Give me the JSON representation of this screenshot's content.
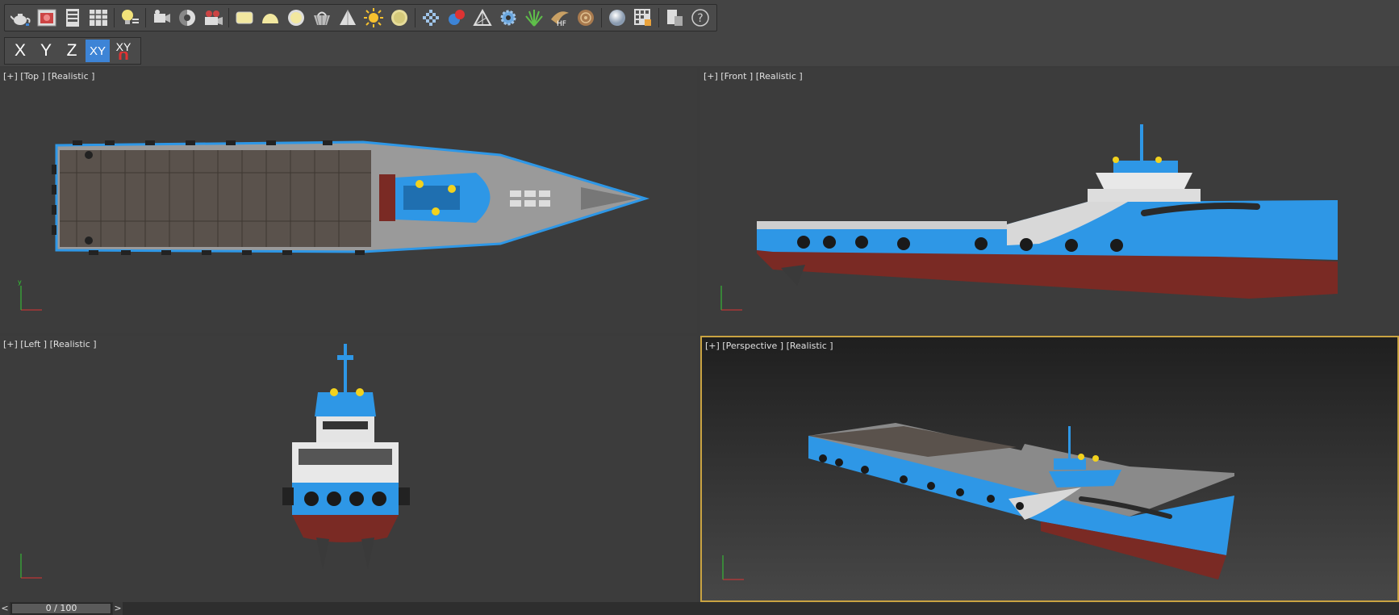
{
  "toolbar": {
    "icons": [
      "teapot-icon",
      "render-frame-icon",
      "render-setup-icon",
      "render-table-icon",
      "light-list-icon",
      "camera-icon",
      "sky-icon",
      "video-camera-icon",
      "plane-icon",
      "dome-icon",
      "sphere-light-icon",
      "basket-icon",
      "cone-icon",
      "sun-icon",
      "disc-icon",
      "grid-icon",
      "shader-ball-icon",
      "triangle-tool-icon",
      "gear-icon",
      "grass-icon",
      "hf-icon",
      "fur-icon",
      "sphere-icon",
      "material-editor-icon",
      "render-message-icon",
      "help-icon"
    ],
    "hf_label": "HF",
    "help_label": "?"
  },
  "axis_constraints": {
    "x": "X",
    "y": "Y",
    "z": "Z",
    "xy": "XY",
    "xyn": "XY",
    "active": "xy"
  },
  "viewports": {
    "top": {
      "label": "[+] [Top ] [Realistic ]"
    },
    "front": {
      "label": "[+] [Front ] [Realistic ]"
    },
    "left": {
      "label": "[+] [Left ] [Realistic ]"
    },
    "perspective": {
      "label": "[+] [Perspective ] [Realistic ]",
      "active": true
    }
  },
  "timeline": {
    "frame": "0 / 100",
    "prev": "<",
    "next": ">"
  },
  "colors": {
    "hull_blue": "#2e97e6",
    "hull_red": "#7a2a24",
    "deck": "#6d625a",
    "active_border": "#c9a342",
    "active_axis": "#3d84d6"
  }
}
